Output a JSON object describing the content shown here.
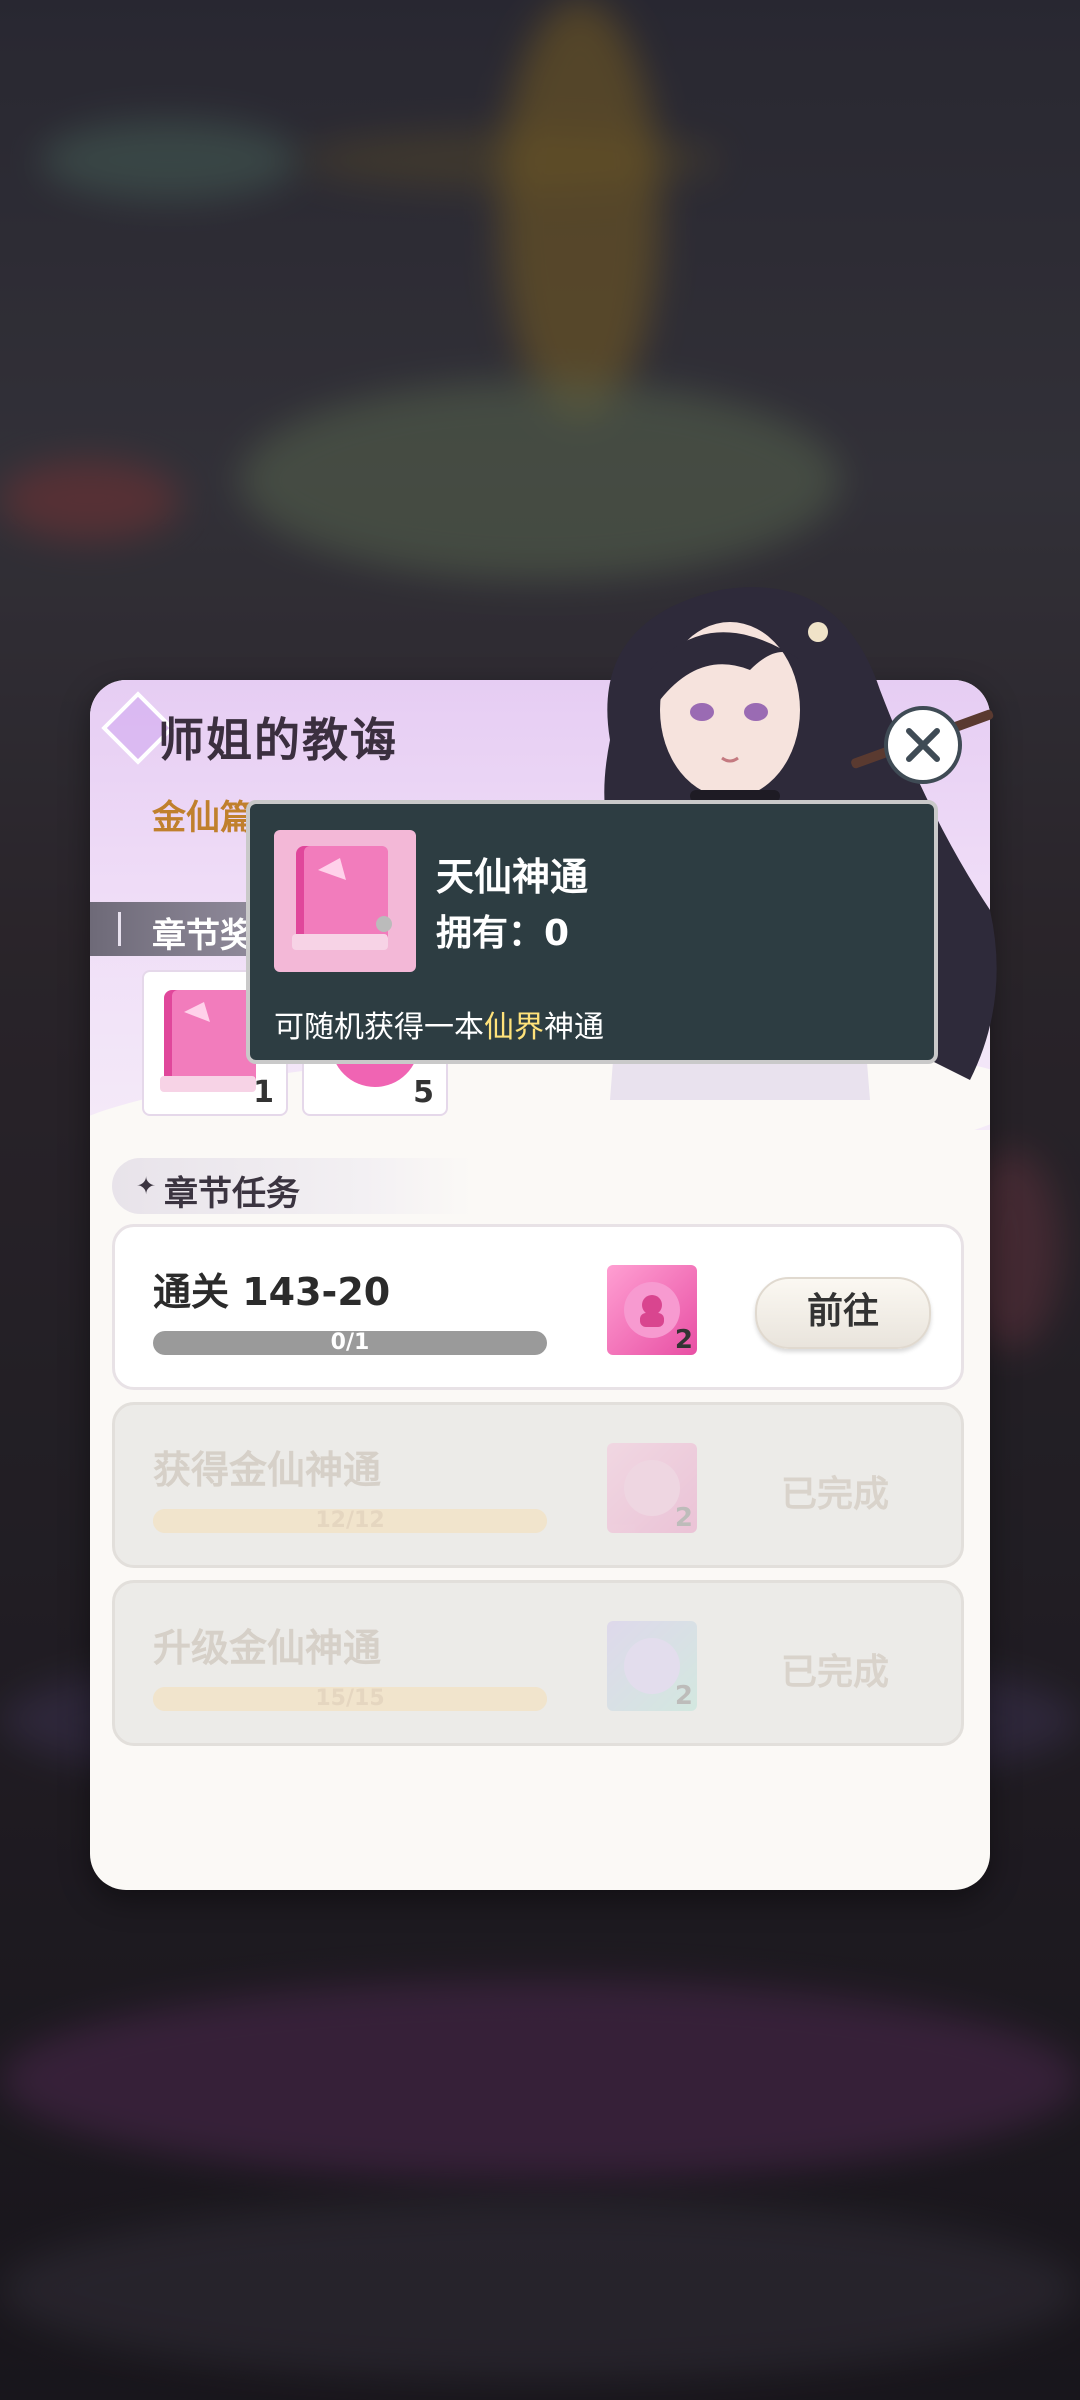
{
  "dialog": {
    "title": "师姐的教诲",
    "subtitle": "金仙篇",
    "section_rewards": "章节奖励",
    "rewards": [
      {
        "icon": "pink-book-icon",
        "count": "1"
      },
      {
        "icon": "pink-orb-icon",
        "count": "5"
      }
    ],
    "section_tasks": "章节任务",
    "tasks": [
      {
        "name": "通关 143-20",
        "progress_text": "0/1",
        "progress": 0.0,
        "reward_count": "2",
        "action": "前往",
        "state": "active"
      },
      {
        "name": "获得金仙神通",
        "progress_text": "12/12",
        "progress": 1.0,
        "reward_count": "2",
        "action": "已完成",
        "state": "done"
      },
      {
        "name": "升级金仙神通",
        "progress_text": "15/15",
        "progress": 1.0,
        "reward_count": "2",
        "action": "已完成",
        "state": "done"
      }
    ]
  },
  "tooltip": {
    "item_name": "天仙神通",
    "owned": "拥有：0",
    "desc_prefix": "可随机获得一本",
    "desc_highlight": "仙界",
    "desc_suffix": "神通"
  },
  "colors": {
    "tooltip_bg": "#2d3d42",
    "highlight": "#ffe27a",
    "subtitle": "#c0802d"
  }
}
